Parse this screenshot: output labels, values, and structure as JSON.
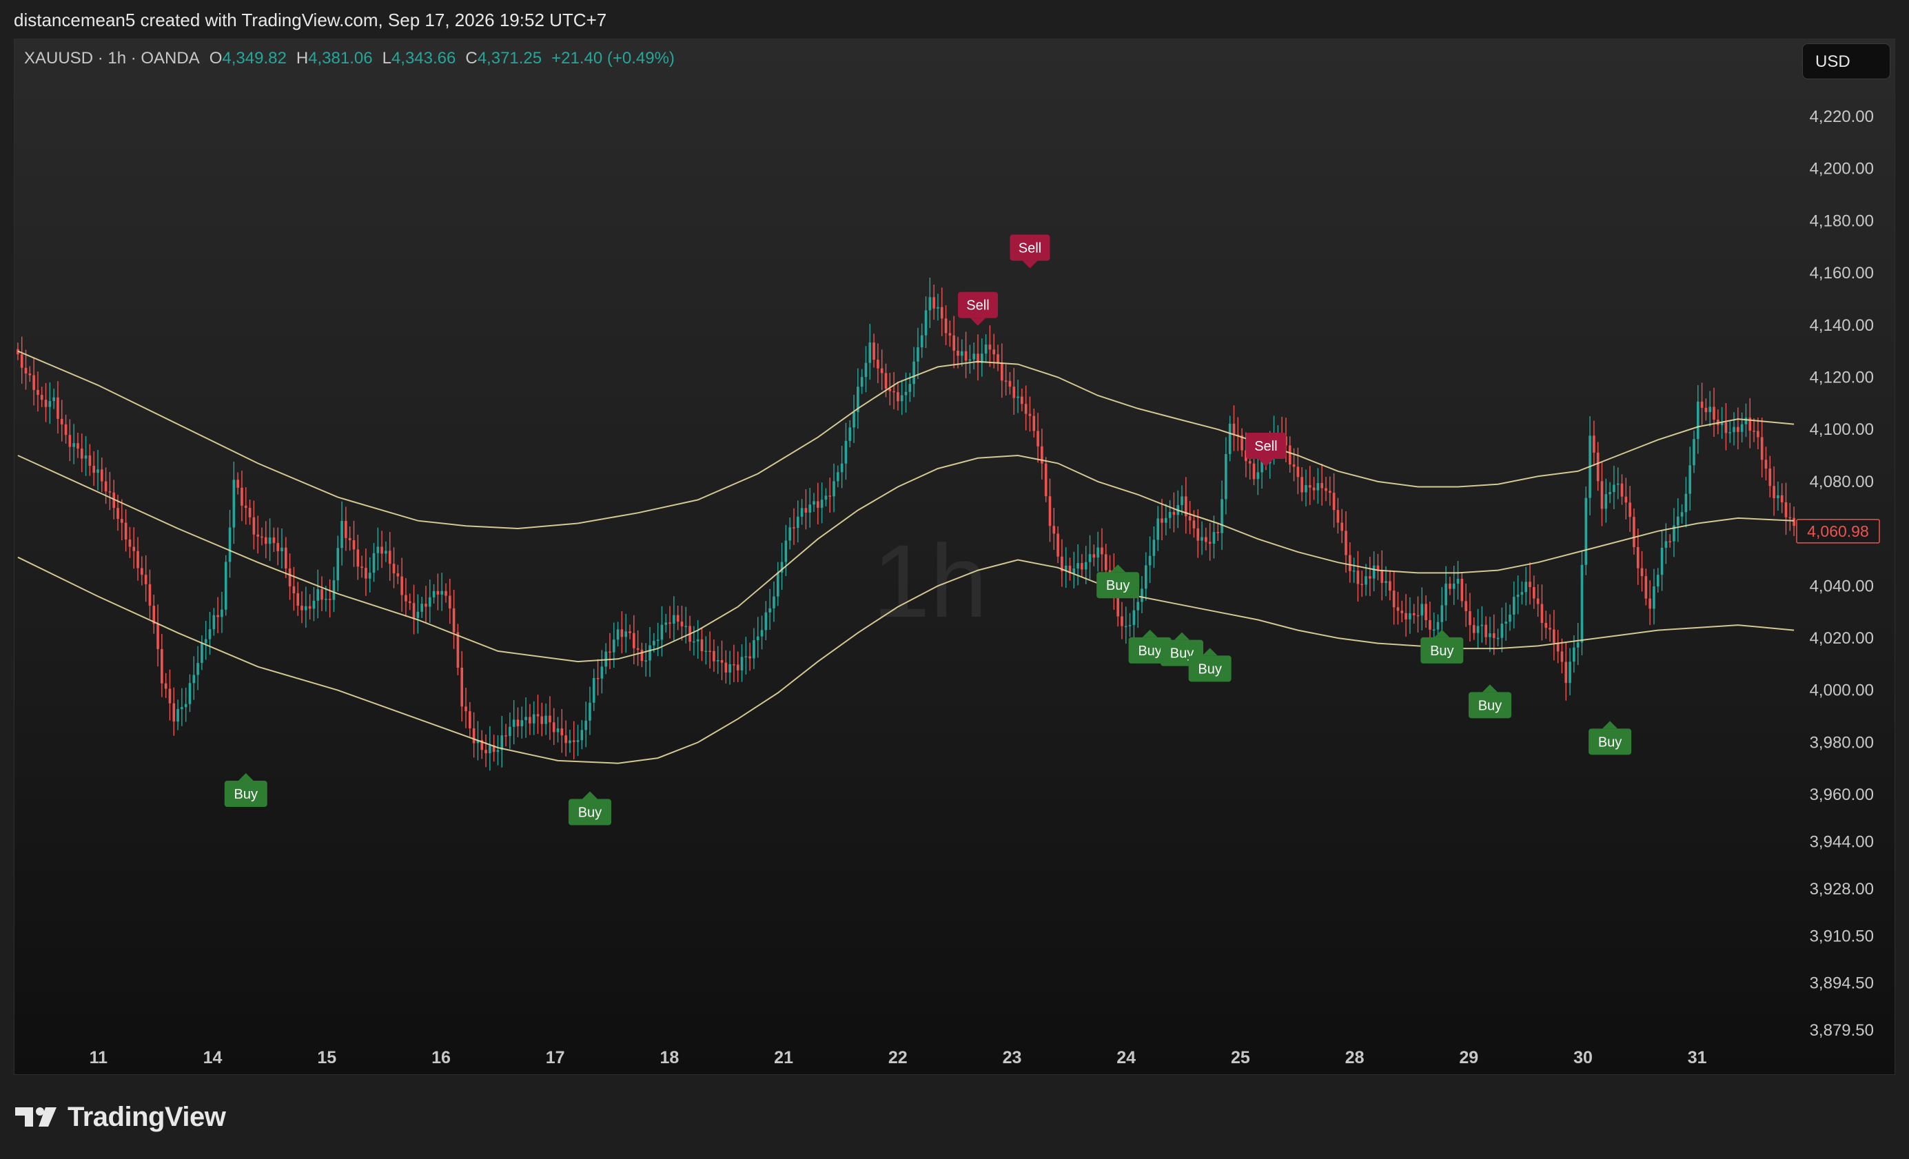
{
  "caption": "distancemean5 created with TradingView.com, Sep 17, 2026 19:52 UTC+7",
  "legend": {
    "symbol": "XAUUSD · 1h · OANDA",
    "o_label": "O",
    "o_value": "4,349.82",
    "h_label": "H",
    "h_value": "4,381.06",
    "l_label": "L",
    "l_value": "4,343.66",
    "c_label": "C",
    "c_value": "4,371.25",
    "change": "+21.40 (+0.49%)"
  },
  "currency": "USD",
  "watermark": "1h",
  "brand": "TradingView",
  "colors": {
    "up": "#26a69a",
    "down": "#ef5350",
    "band": "#e8dca0",
    "buy": "#2e7d32",
    "sell": "#a3193d",
    "price_label": "#ef5350"
  },
  "chart_data": {
    "type": "candlestick",
    "symbol": "XAUUSD",
    "interval": "1h",
    "y_ticks": [
      "4,220.00",
      "4,200.00",
      "4,180.00",
      "4,160.00",
      "4,140.00",
      "4,120.00",
      "4,100.00",
      "4,080.00",
      "4,060.00",
      "4,040.00",
      "4,020.00",
      "4,000.00",
      "3,980.00",
      "3,960.00",
      "3,944.00",
      "3,928.00",
      "3,910.50",
      "3,894.50",
      "3,879.50"
    ],
    "x_ticks": [
      "11",
      "14",
      "15",
      "16",
      "17",
      "18",
      "21",
      "22",
      "23",
      "24",
      "25",
      "28",
      "29",
      "30",
      "31"
    ],
    "last_price": "4,060.98",
    "close_path": [
      [
        0,
        4127
      ],
      [
        3,
        4116
      ],
      [
        6,
        4108
      ],
      [
        9,
        4113
      ],
      [
        12,
        4100
      ],
      [
        15,
        4092
      ],
      [
        18,
        4083
      ],
      [
        21,
        4079
      ],
      [
        24,
        4073
      ],
      [
        27,
        4062
      ],
      [
        30,
        4048
      ],
      [
        33,
        4031
      ],
      [
        36,
        4003
      ],
      [
        39,
        3992
      ],
      [
        42,
        3999
      ],
      [
        45,
        4011
      ],
      [
        48,
        4021
      ],
      [
        51,
        4030
      ],
      [
        54,
        4083
      ],
      [
        57,
        4072
      ],
      [
        60,
        4057
      ],
      [
        63,
        4054
      ],
      [
        66,
        4052
      ],
      [
        69,
        4038
      ],
      [
        72,
        4033
      ],
      [
        75,
        4036
      ],
      [
        78,
        4030
      ],
      [
        81,
        4063
      ],
      [
        84,
        4056
      ],
      [
        87,
        4045
      ],
      [
        90,
        4054
      ],
      [
        93,
        4046
      ],
      [
        96,
        4037
      ],
      [
        99,
        4032
      ],
      [
        102,
        4036
      ],
      [
        105,
        4037
      ],
      [
        108,
        4030
      ],
      [
        111,
        3995
      ],
      [
        114,
        3984
      ],
      [
        117,
        3979
      ],
      [
        120,
        3976
      ],
      [
        123,
        3983
      ],
      [
        126,
        3988
      ],
      [
        129,
        3993
      ],
      [
        132,
        3991
      ],
      [
        135,
        3982
      ],
      [
        138,
        3976
      ],
      [
        141,
        3983
      ],
      [
        144,
        4006
      ],
      [
        147,
        4015
      ],
      [
        150,
        4020
      ],
      [
        153,
        4018
      ],
      [
        156,
        4011
      ],
      [
        159,
        4022
      ],
      [
        162,
        4028
      ],
      [
        165,
        4025
      ],
      [
        168,
        4017
      ],
      [
        171,
        4017
      ],
      [
        174,
        4016
      ],
      [
        177,
        4010
      ],
      [
        180,
        4007
      ],
      [
        183,
        4011
      ],
      [
        186,
        4025
      ],
      [
        189,
        4040
      ],
      [
        192,
        4059
      ],
      [
        195,
        4064
      ],
      [
        198,
        4068
      ],
      [
        201,
        4073
      ],
      [
        204,
        4082
      ],
      [
        207,
        4095
      ],
      [
        210,
        4112
      ],
      [
        213,
        4129
      ],
      [
        216,
        4121
      ],
      [
        219,
        4116
      ],
      [
        222,
        4114
      ],
      [
        225,
        4128
      ],
      [
        228,
        4148
      ],
      [
        231,
        4144
      ],
      [
        234,
        4134
      ],
      [
        237,
        4128
      ],
      [
        240,
        4124
      ],
      [
        243,
        4130
      ],
      [
        246,
        4122
      ],
      [
        249,
        4117
      ],
      [
        252,
        4108
      ],
      [
        255,
        4092
      ],
      [
        258,
        4062
      ],
      [
        261,
        4048
      ],
      [
        264,
        4050
      ],
      [
        267,
        4049
      ],
      [
        270,
        4051
      ],
      [
        273,
        4042
      ],
      [
        276,
        4025
      ],
      [
        279,
        4032
      ],
      [
        282,
        4046
      ],
      [
        285,
        4061
      ],
      [
        288,
        4065
      ],
      [
        291,
        4075
      ],
      [
        294,
        4064
      ],
      [
        297,
        4056
      ],
      [
        300,
        4057
      ],
      [
        303,
        4101
      ],
      [
        306,
        4095
      ],
      [
        309,
        4085
      ],
      [
        312,
        4088
      ],
      [
        315,
        4097
      ],
      [
        318,
        4087
      ],
      [
        321,
        4080
      ],
      [
        324,
        4081
      ],
      [
        327,
        4077
      ],
      [
        330,
        4062
      ],
      [
        333,
        4045
      ],
      [
        336,
        4043
      ],
      [
        339,
        4050
      ],
      [
        342,
        4040
      ],
      [
        345,
        4026
      ],
      [
        348,
        4027
      ],
      [
        351,
        4034
      ],
      [
        354,
        4024
      ],
      [
        357,
        4038
      ],
      [
        360,
        4038
      ],
      [
        363,
        4023
      ],
      [
        366,
        4027
      ],
      [
        369,
        4022
      ],
      [
        372,
        4025
      ],
      [
        375,
        4034
      ],
      [
        378,
        4040
      ],
      [
        381,
        4030
      ],
      [
        384,
        4022
      ],
      [
        387,
        4003
      ],
      [
        390,
        4017
      ],
      [
        393,
        4099
      ],
      [
        396,
        4074
      ],
      [
        399,
        4082
      ],
      [
        402,
        4071
      ],
      [
        405,
        4044
      ],
      [
        408,
        4031
      ],
      [
        411,
        4057
      ],
      [
        414,
        4064
      ],
      [
        417,
        4072
      ],
      [
        420,
        4106
      ],
      [
        423,
        4107
      ],
      [
        426,
        4104
      ],
      [
        429,
        4101
      ],
      [
        432,
        4101
      ],
      [
        435,
        4093
      ],
      [
        438,
        4078
      ],
      [
        441,
        4075
      ],
      [
        444,
        4063
      ]
    ],
    "bands": {
      "upper": [
        [
          0,
          4130
        ],
        [
          20,
          4117
        ],
        [
          40,
          4102
        ],
        [
          60,
          4087
        ],
        [
          80,
          4074
        ],
        [
          100,
          4065
        ],
        [
          112,
          4063
        ],
        [
          125,
          4062
        ],
        [
          140,
          4064
        ],
        [
          155,
          4068
        ],
        [
          170,
          4073
        ],
        [
          185,
          4083
        ],
        [
          200,
          4097
        ],
        [
          210,
          4108
        ],
        [
          220,
          4118
        ],
        [
          230,
          4124
        ],
        [
          240,
          4126
        ],
        [
          250,
          4125
        ],
        [
          260,
          4120
        ],
        [
          270,
          4113
        ],
        [
          280,
          4108
        ],
        [
          290,
          4104
        ],
        [
          300,
          4100
        ],
        [
          310,
          4095
        ],
        [
          320,
          4090
        ],
        [
          330,
          4084
        ],
        [
          340,
          4080
        ],
        [
          350,
          4078
        ],
        [
          360,
          4078
        ],
        [
          370,
          4079
        ],
        [
          380,
          4082
        ],
        [
          390,
          4084
        ],
        [
          400,
          4090
        ],
        [
          410,
          4096
        ],
        [
          420,
          4101
        ],
        [
          430,
          4104
        ],
        [
          444,
          4102
        ]
      ],
      "middle": [
        [
          0,
          4090
        ],
        [
          20,
          4076
        ],
        [
          40,
          4062
        ],
        [
          60,
          4049
        ],
        [
          80,
          4037
        ],
        [
          100,
          4027
        ],
        [
          120,
          4015
        ],
        [
          140,
          4011
        ],
        [
          150,
          4012
        ],
        [
          160,
          4016
        ],
        [
          170,
          4023
        ],
        [
          180,
          4032
        ],
        [
          190,
          4045
        ],
        [
          200,
          4058
        ],
        [
          210,
          4069
        ],
        [
          220,
          4078
        ],
        [
          230,
          4085
        ],
        [
          240,
          4089
        ],
        [
          250,
          4090
        ],
        [
          260,
          4087
        ],
        [
          270,
          4080
        ],
        [
          280,
          4075
        ],
        [
          290,
          4069
        ],
        [
          300,
          4064
        ],
        [
          310,
          4058
        ],
        [
          320,
          4053
        ],
        [
          330,
          4049
        ],
        [
          340,
          4046
        ],
        [
          350,
          4045
        ],
        [
          360,
          4045
        ],
        [
          370,
          4046
        ],
        [
          380,
          4049
        ],
        [
          390,
          4053
        ],
        [
          400,
          4057
        ],
        [
          410,
          4061
        ],
        [
          420,
          4064
        ],
        [
          430,
          4066
        ],
        [
          444,
          4065
        ]
      ],
      "lower": [
        [
          0,
          4051
        ],
        [
          20,
          4036
        ],
        [
          40,
          4022
        ],
        [
          60,
          4009
        ],
        [
          80,
          4000
        ],
        [
          100,
          3989
        ],
        [
          120,
          3978
        ],
        [
          135,
          3973
        ],
        [
          150,
          3972
        ],
        [
          160,
          3974
        ],
        [
          170,
          3980
        ],
        [
          180,
          3989
        ],
        [
          190,
          3999
        ],
        [
          200,
          4011
        ],
        [
          210,
          4022
        ],
        [
          220,
          4032
        ],
        [
          230,
          4040
        ],
        [
          240,
          4046
        ],
        [
          250,
          4050
        ],
        [
          260,
          4047
        ],
        [
          270,
          4041
        ],
        [
          280,
          4036
        ],
        [
          290,
          4033
        ],
        [
          300,
          4030
        ],
        [
          310,
          4027
        ],
        [
          320,
          4023
        ],
        [
          330,
          4020
        ],
        [
          340,
          4018
        ],
        [
          350,
          4017
        ],
        [
          360,
          4016
        ],
        [
          370,
          4016
        ],
        [
          380,
          4017
        ],
        [
          390,
          4019
        ],
        [
          400,
          4021
        ],
        [
          410,
          4023
        ],
        [
          420,
          4024
        ],
        [
          430,
          4025
        ],
        [
          444,
          4023
        ]
      ]
    },
    "signals": [
      {
        "label": "Buy",
        "bar": 57,
        "price": 3969,
        "side": "below"
      },
      {
        "label": "Buy",
        "bar": 143,
        "price": 3962,
        "side": "below"
      },
      {
        "label": "Sell",
        "bar": 240,
        "price": 4139,
        "side": "above"
      },
      {
        "label": "Sell",
        "bar": 253,
        "price": 4161,
        "side": "above"
      },
      {
        "label": "Buy",
        "bar": 275,
        "price": 4049,
        "side": "below"
      },
      {
        "label": "Buy",
        "bar": 283,
        "price": 4024,
        "side": "below"
      },
      {
        "label": "Buy",
        "bar": 291,
        "price": 4023,
        "side": "below"
      },
      {
        "label": "Buy",
        "bar": 298,
        "price": 4017,
        "side": "below"
      },
      {
        "label": "Sell",
        "bar": 312,
        "price": 4085,
        "side": "above"
      },
      {
        "label": "Buy",
        "bar": 356,
        "price": 4024,
        "side": "below"
      },
      {
        "label": "Buy",
        "bar": 368,
        "price": 4003,
        "side": "below"
      },
      {
        "label": "Buy",
        "bar": 398,
        "price": 3989,
        "side": "below"
      }
    ]
  }
}
